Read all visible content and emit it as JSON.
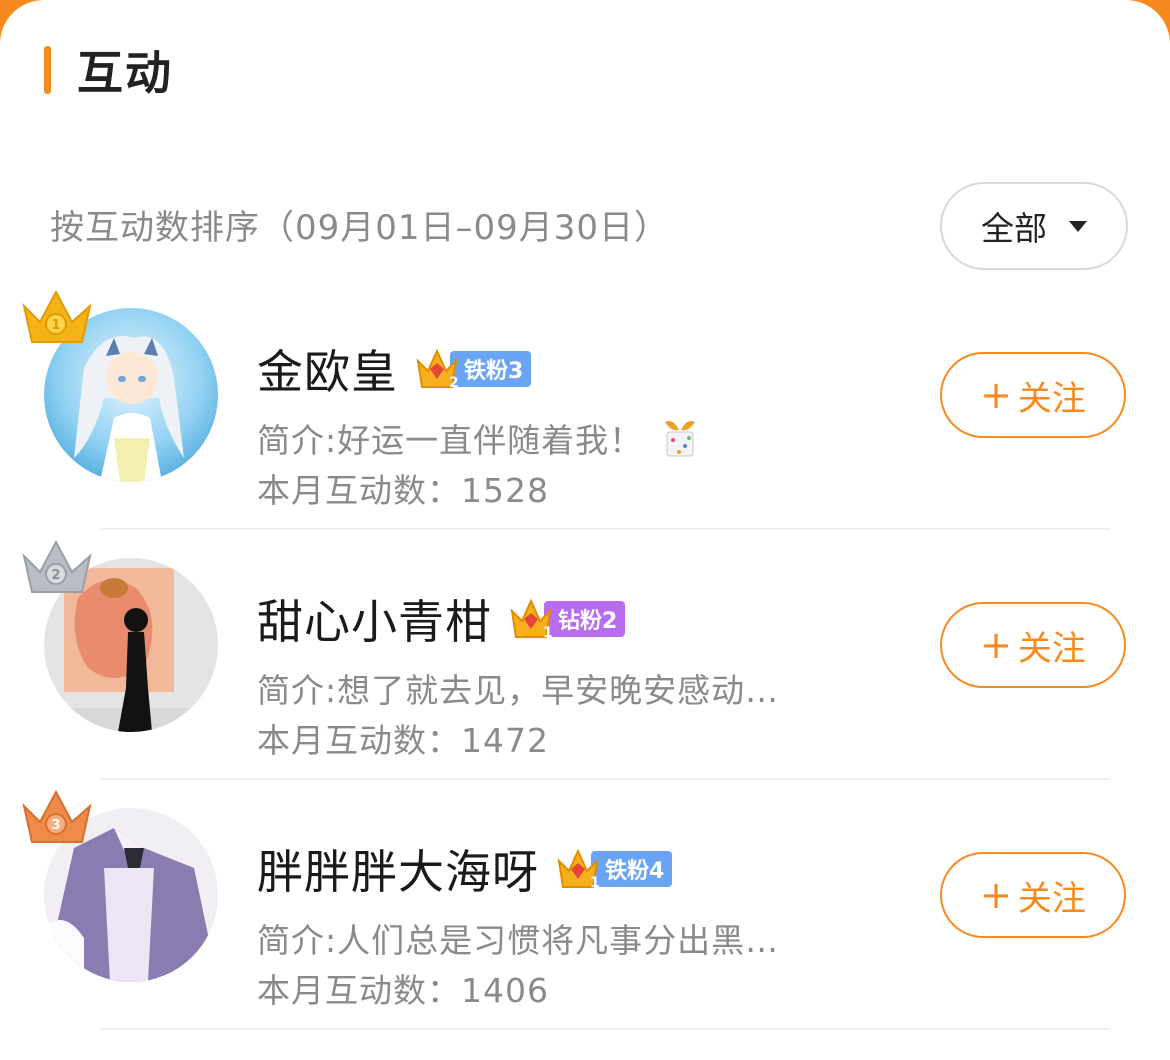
{
  "section": {
    "title": "互动"
  },
  "sort": {
    "label": "按互动数排序（09月01日–09月30日）"
  },
  "filter": {
    "label": "全部"
  },
  "colors": {
    "accent": "#f78a1f",
    "gold": "#f5b316",
    "silver": "#b9bdc4",
    "bronze": "#f08a4b",
    "iron_badge": "#6aa5f5",
    "diamond_badge": "#b86cf0"
  },
  "users": [
    {
      "rank": "1",
      "rank_icon": "gold-crown-icon",
      "name": "金欧皇",
      "badge": {
        "level": "2",
        "label": "铁粉3",
        "color": "#6aa5f5"
      },
      "intro": "简介:好运一直伴随着我！",
      "intro_emoji": "gift-emoji-icon",
      "count": "本月互动数：1528",
      "follow": {
        "plus": "+",
        "label": "关注"
      }
    },
    {
      "rank": "2",
      "rank_icon": "silver-crown-icon",
      "name": "甜心小青柑",
      "badge": {
        "level": "1",
        "label": "钻粉2",
        "color": "#b86cf0"
      },
      "intro": "简介:想了就去见，早安晚安感动…",
      "count": "本月互动数：1472",
      "follow": {
        "plus": "+",
        "label": "关注"
      }
    },
    {
      "rank": "3",
      "rank_icon": "bronze-crown-icon",
      "name": "胖胖胖大海呀",
      "badge": {
        "level": "1",
        "label": "铁粉4",
        "color": "#6aa5f5"
      },
      "intro": "简介:人们总是习惯将凡事分出黑…",
      "count": "本月互动数：1406",
      "follow": {
        "plus": "+",
        "label": "关注"
      }
    }
  ]
}
